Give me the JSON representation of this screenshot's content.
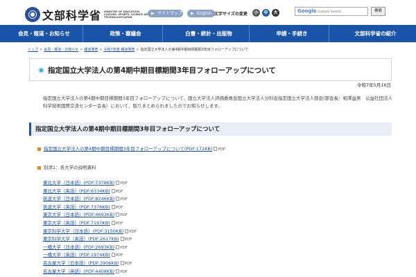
{
  "header": {
    "logo_text": "文部科学省",
    "logo_sub": "MINISTRY OF EDUCATION, CULTURE, SPORTS, SCIENCE AND TECHNOLOGY-JAPAN",
    "sitemap_label": "サイトマップ",
    "english_label": "English",
    "fontsize_label": "文字サイズの変更",
    "fontsize_small": "小",
    "fontsize_mid": "中",
    "fontsize_large": "大",
    "search_brand": "Google",
    "search_placeholder": "Custom Search",
    "search_button": "検索"
  },
  "nav": {
    "items": [
      {
        "label": "会見・報道・お知らせ"
      },
      {
        "label": "政策・審議会"
      },
      {
        "label": "白書・統計・出版物"
      },
      {
        "label": "申請・手続き"
      },
      {
        "label": "文部科学省の紹介"
      }
    ]
  },
  "breadcrumb": {
    "items": [
      "トップ",
      "会見・報道・お知らせ",
      "報道発表",
      "令和7年度 報道発表"
    ],
    "current": "指定国立大学法人の第4期中期目標期間3年目フォローアップについて"
  },
  "page": {
    "title": "指定国立大学法人の第4期中期目標期間3年目フォローアップについて",
    "date": "令和7年5月16日",
    "intro": "指定国立大学法人の第4期中期目標期間3年目フォローアップについて、国立大学法人評価委員会国立大学法人分科会指定国立大学法人部会(部会長：相澤益男　公益社団法人科学技術国際交流センター会長）において、取りまとめられましたのでお知らせします。",
    "section_title": "指定国立大学法人の第4期中期目標期間3年目フォローアップについて",
    "main_link": "指定国立大学法人の第4期中期目標期間3年目フォローアップについて(PDF:172KB)",
    "pdf_label": "PDF",
    "annex": "別添1：各大学の説明資料"
  },
  "universities": [
    {
      "label": "東北大学（日本語）(PDF:7378KB)"
    },
    {
      "label": "東北大学（英語）(PDF:6334KB)"
    },
    {
      "label": "筑波大学（日本語）(PDF:8246KB)"
    },
    {
      "label": "筑波大学（英語）(PDF:7376KB)"
    },
    {
      "label": "東京大学（日本語）(PDF:4693KB)"
    },
    {
      "label": "東京大学（英語）(PDF:7197KB)"
    },
    {
      "label": "東京科学大学（日本語）(PDF:3150KB)"
    },
    {
      "label": "東京科学大学（英語）(PDF:2617KB)"
    },
    {
      "label": "一橋大学（日本語）(PDF:2693KB)"
    },
    {
      "label": "一橋大学（英語）(PDF:1974KB)"
    },
    {
      "label": "名古屋大学（日本語）(PDF:3906KB)"
    },
    {
      "label": "名古屋大学（英語）(PDF:4408KB)"
    }
  ],
  "colors": {
    "nav_bg": "#1a54a8",
    "link": "#1a4fa0",
    "bullet": "#e08a1e",
    "title_icon": "#3ea8c8"
  }
}
